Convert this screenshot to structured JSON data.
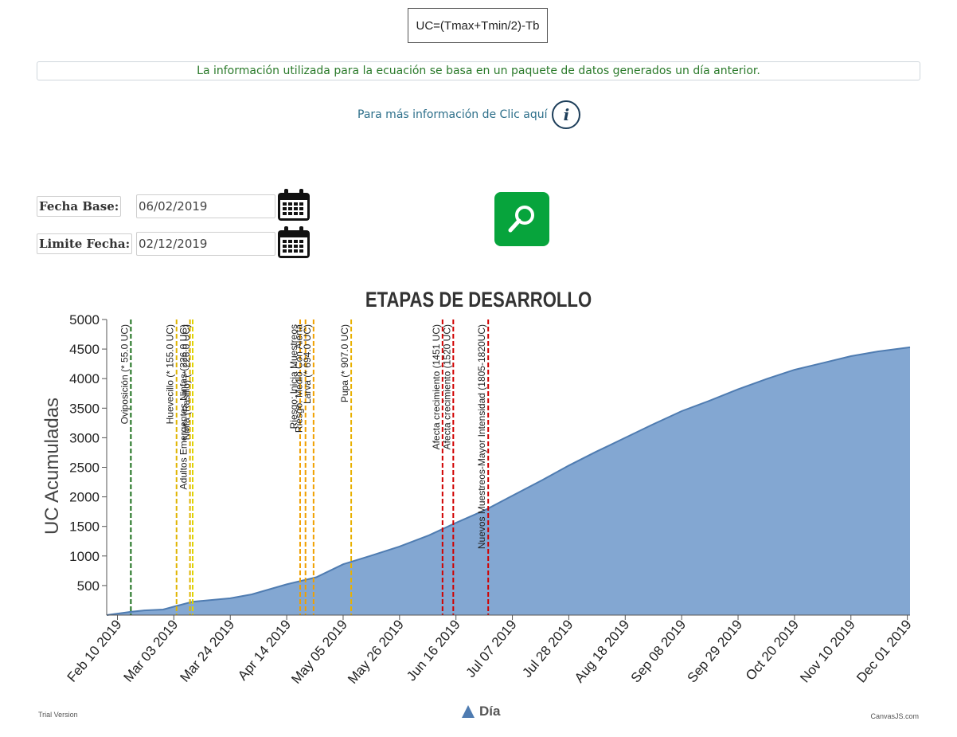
{
  "header": {
    "formula": "UC=(Tmax+Tmin/2)-Tb",
    "info_banner": "La información utilizada para la ecuación se basa en un paquete de datos generados un día anterior.",
    "more_info_text": "Para más información de Clic aquí",
    "info_icon": "i"
  },
  "form": {
    "base_date_label": "Fecha Base:",
    "base_date_value": "06/02/2019",
    "limit_date_label": "Limite Fecha:",
    "limit_date_value": "02/12/2019",
    "calendar_icon": "calendar-icon",
    "search_icon": "magnifier-icon",
    "search_color": "#07a43c"
  },
  "chart_data": {
    "type": "area",
    "title": "ETAPAS DE DESARROLLO",
    "ylabel": "UC Acumuladas",
    "xlabel": "",
    "legend": "Día",
    "legend_position": "bottom-center",
    "area_color": "#83a7d2",
    "line_color": "#4f7cb1",
    "grid": false,
    "ylim": [
      0,
      5000
    ],
    "yticks": [
      500,
      1000,
      1500,
      2000,
      2500,
      3000,
      3500,
      4000,
      4500,
      5000
    ],
    "xlim": [
      "2019-02-06",
      "2019-12-02"
    ],
    "xticks": [
      {
        "date": "2019-02-10",
        "label": "Feb 10 2019"
      },
      {
        "date": "2019-03-03",
        "label": "Mar 03 2019"
      },
      {
        "date": "2019-03-24",
        "label": "Mar 24 2019"
      },
      {
        "date": "2019-04-14",
        "label": "Apr 14 2019"
      },
      {
        "date": "2019-05-05",
        "label": "May 05 2019"
      },
      {
        "date": "2019-05-26",
        "label": "May 26 2019"
      },
      {
        "date": "2019-06-16",
        "label": "Jun 16 2019"
      },
      {
        "date": "2019-07-07",
        "label": "Jul 07 2019"
      },
      {
        "date": "2019-07-28",
        "label": "Jul 28 2019"
      },
      {
        "date": "2019-08-18",
        "label": "Aug 18 2019"
      },
      {
        "date": "2019-09-08",
        "label": "Sep 08 2019"
      },
      {
        "date": "2019-09-29",
        "label": "Sep 29 2019"
      },
      {
        "date": "2019-10-20",
        "label": "Oct 20 2019"
      },
      {
        "date": "2019-11-10",
        "label": "Nov 10 2019"
      },
      {
        "date": "2019-12-01",
        "label": "Dec 01 2019"
      }
    ],
    "series": [
      {
        "name": "Día",
        "points": [
          {
            "x": "2019-02-06",
            "y": 0
          },
          {
            "x": "2019-02-15",
            "y": 55
          },
          {
            "x": "2019-02-20",
            "y": 80
          },
          {
            "x": "2019-02-27",
            "y": 95
          },
          {
            "x": "2019-03-04",
            "y": 155
          },
          {
            "x": "2019-03-10",
            "y": 226
          },
          {
            "x": "2019-03-24",
            "y": 285
          },
          {
            "x": "2019-04-01",
            "y": 350
          },
          {
            "x": "2019-04-14",
            "y": 520
          },
          {
            "x": "2019-04-25",
            "y": 640
          },
          {
            "x": "2019-05-05",
            "y": 860
          },
          {
            "x": "2019-05-15",
            "y": 1000
          },
          {
            "x": "2019-05-26",
            "y": 1160
          },
          {
            "x": "2019-06-06",
            "y": 1350
          },
          {
            "x": "2019-06-16",
            "y": 1560
          },
          {
            "x": "2019-06-27",
            "y": 1780
          },
          {
            "x": "2019-07-07",
            "y": 2020
          },
          {
            "x": "2019-07-18",
            "y": 2280
          },
          {
            "x": "2019-07-28",
            "y": 2530
          },
          {
            "x": "2019-08-07",
            "y": 2760
          },
          {
            "x": "2019-08-18",
            "y": 3000
          },
          {
            "x": "2019-08-28",
            "y": 3220
          },
          {
            "x": "2019-09-08",
            "y": 3450
          },
          {
            "x": "2019-09-18",
            "y": 3620
          },
          {
            "x": "2019-09-29",
            "y": 3820
          },
          {
            "x": "2019-10-10",
            "y": 4000
          },
          {
            "x": "2019-10-20",
            "y": 4150
          },
          {
            "x": "2019-10-31",
            "y": 4270
          },
          {
            "x": "2019-11-10",
            "y": 4380
          },
          {
            "x": "2019-11-20",
            "y": 4460
          },
          {
            "x": "2019-12-02",
            "y": 4530
          }
        ]
      }
    ],
    "stages": [
      {
        "date": "2019-02-15",
        "label": "Oviposición (* 55.0 UC)",
        "color": "#1a6e1a"
      },
      {
        "date": "2019-03-04",
        "label": "Huevecillo (* 155.0 UC)",
        "color": "#e0b400"
      },
      {
        "date": "2019-03-09",
        "label": "Adultos Emergentes Ninfas (226.0 UC)",
        "color": "#e0b400"
      },
      {
        "date": "2019-03-10",
        "label": "Ninfa (Rasillo) (* 226.0 UC)",
        "color": "#e0d400"
      },
      {
        "date": "2019-04-19",
        "label": "Riesgo: Inicia Muestreos",
        "color": "#f0a000"
      },
      {
        "date": "2019-04-21",
        "label": "Riesgo: Medio Con Alerta",
        "color": "#f0a000"
      },
      {
        "date": "2019-04-24",
        "label": "Larva (* 694.0 UC)",
        "color": "#f0a000"
      },
      {
        "date": "2019-05-08",
        "label": "Pupa (* 907.0 UC)",
        "color": "#e8b000"
      },
      {
        "date": "2019-06-11",
        "label": "Afecta crecimiento (1451 UC)",
        "color": "#d00000"
      },
      {
        "date": "2019-06-15",
        "label": "Afecta crecimiento (1520 UC)",
        "color": "#d00000"
      },
      {
        "date": "2019-06-28",
        "label": "Nuevos Muestreos-Mayor Intensidad (1805-1820UC)",
        "color": "#d00000"
      }
    ]
  },
  "footer": {
    "left": "Trial Version",
    "right": "CanvasJS.com"
  }
}
